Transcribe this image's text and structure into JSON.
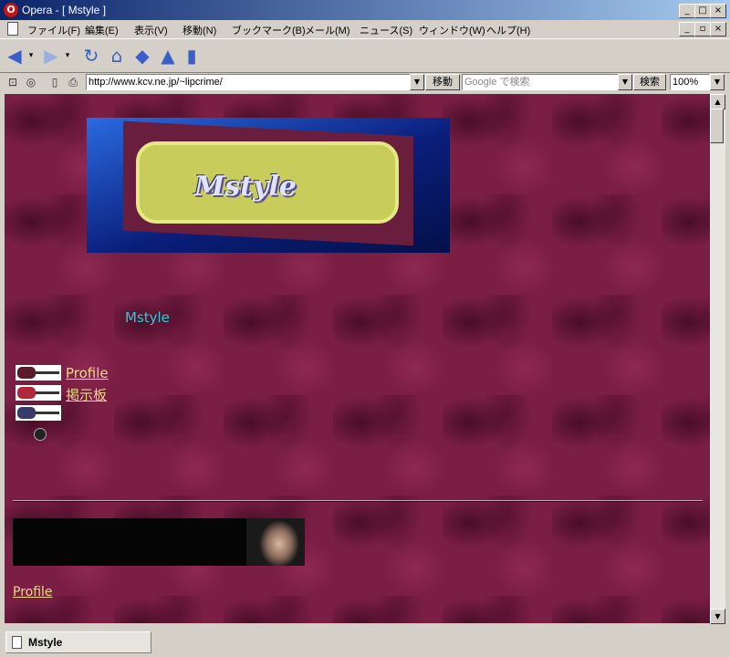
{
  "window": {
    "title": "Opera - [ Mstyle ]",
    "controls": [
      "_",
      "□",
      "×"
    ],
    "doc_controls": [
      "_",
      "▫",
      "×"
    ]
  },
  "menu": {
    "items": [
      "ファイル(F)",
      "編集(E)",
      "表示(V)",
      "移動(N)",
      "ブックマーク(B)",
      "メール(M)",
      "ニュース(S)",
      "ウィンドウ(W)",
      "ヘルプ(H)"
    ]
  },
  "address_bar": {
    "url": "http://www.kcv.ne.jp/~lipcrime/",
    "go_label": "移動"
  },
  "search_bar": {
    "placeholder": "Google で検索",
    "search_label": "検索"
  },
  "zoom": {
    "value": "100%"
  },
  "page": {
    "banner_text": "Mstyle",
    "site_title": "Mstyle",
    "nav": [
      {
        "label": "Profile"
      },
      {
        "label": "掲示板"
      },
      {
        "label": ""
      }
    ],
    "bottom_link": "Profile"
  },
  "status": {
    "tab_title": "Mstyle"
  },
  "colors": {
    "page_bg": "#7a1e44",
    "link": "#f0d88a",
    "site_title": "#33c8d8"
  }
}
